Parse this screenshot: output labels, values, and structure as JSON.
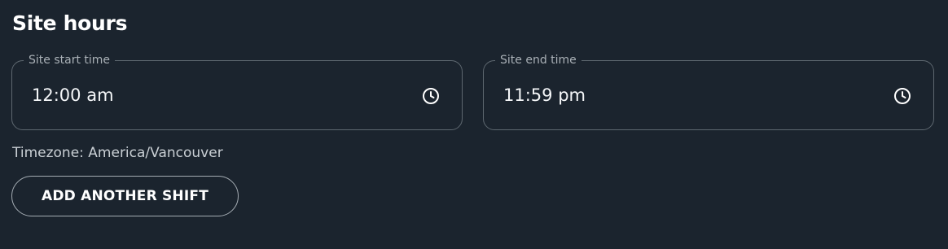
{
  "section": {
    "title": "Site hours"
  },
  "start_time": {
    "label": "Site start time",
    "value": "12:00 am",
    "icon": "clock-icon"
  },
  "end_time": {
    "label": "Site end time",
    "value": "11:59 pm",
    "icon": "clock-icon"
  },
  "timezone": {
    "text": "Timezone: America/Vancouver"
  },
  "actions": {
    "add_shift_label": "ADD ANOTHER SHIFT"
  },
  "colors": {
    "background": "#1b242e",
    "field_border": "#5e6870",
    "text": "#ffffff",
    "muted_text": "#a9b0b6"
  }
}
